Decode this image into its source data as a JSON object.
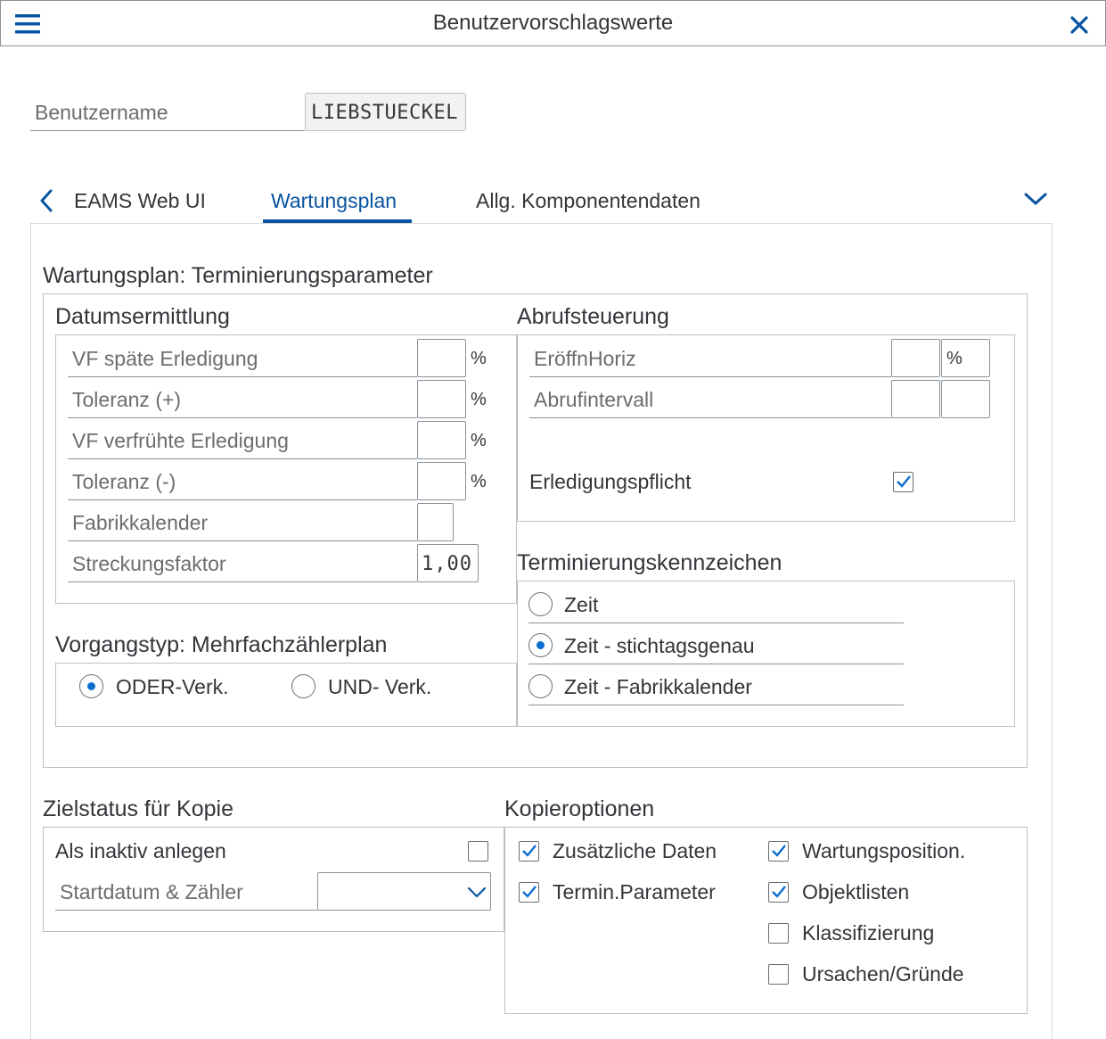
{
  "header": {
    "title": "Benutzervorschlagswerte"
  },
  "user": {
    "label": "Benutzername",
    "value": "LIEBSTUECKEL"
  },
  "tabs": [
    {
      "label": "EAMS Web UI",
      "selected": false
    },
    {
      "label": "Wartungsplan",
      "selected": true
    },
    {
      "label": "Allg. Komponentendaten",
      "selected": false
    }
  ],
  "section_title": "Wartungsplan: Terminierungsparameter",
  "datum": {
    "title": "Datumsermittlung",
    "rows": [
      {
        "label": "VF späte Erledigung",
        "value": "",
        "unit": "%"
      },
      {
        "label": "Toleranz (+)",
        "value": "",
        "unit": "%"
      },
      {
        "label": "VF verfrühte Erledigung",
        "value": "",
        "unit": "%"
      },
      {
        "label": "Toleranz (-)",
        "value": "",
        "unit": "%"
      },
      {
        "label": "Fabrikkalender",
        "value": "",
        "unit": ""
      },
      {
        "label": "Streckungsfaktor",
        "value": "1,00",
        "unit": ""
      }
    ]
  },
  "abruf": {
    "title": "Abrufsteuerung",
    "rows": [
      {
        "label": "EröffnHoriz",
        "value": "",
        "unit": "%"
      },
      {
        "label": "Abrufintervall",
        "value": "",
        "unit": ""
      }
    ],
    "erledigung": {
      "label": "Erledigungspflicht",
      "checked": true
    }
  },
  "vorgang": {
    "title": "Vorgangstyp: Mehrfachzählerplan",
    "options": [
      {
        "label": "ODER-Verk.",
        "selected": true
      },
      {
        "label": "UND- Verk.",
        "selected": false
      }
    ]
  },
  "termin": {
    "title": "Terminierungskennzeichen",
    "options": [
      {
        "label": "Zeit",
        "selected": false
      },
      {
        "label": "Zeit - stichtagsgenau",
        "selected": true
      },
      {
        "label": "Zeit - Fabrikkalender",
        "selected": false
      }
    ]
  },
  "ziel": {
    "title": "Zielstatus für Kopie",
    "inaktiv": {
      "label": "Als inaktiv anlegen",
      "checked": false
    },
    "startdatum": {
      "label": "Startdatum & Zähler",
      "value": ""
    }
  },
  "kopie": {
    "title": "Kopieroptionen",
    "left": [
      {
        "label": "Zusätzliche Daten",
        "checked": true
      },
      {
        "label": "Termin.Parameter",
        "checked": true
      }
    ],
    "right": [
      {
        "label": "Wartungsposition.",
        "checked": true
      },
      {
        "label": "Objektlisten",
        "checked": true
      },
      {
        "label": "Klassifizierung",
        "checked": false
      },
      {
        "label": "Ursachen/Gründe",
        "checked": false
      }
    ]
  },
  "colors": {
    "accent": "#0a6ed1",
    "header_icon": "#0854a0",
    "text": "#32363a",
    "label": "#6a6d70"
  }
}
